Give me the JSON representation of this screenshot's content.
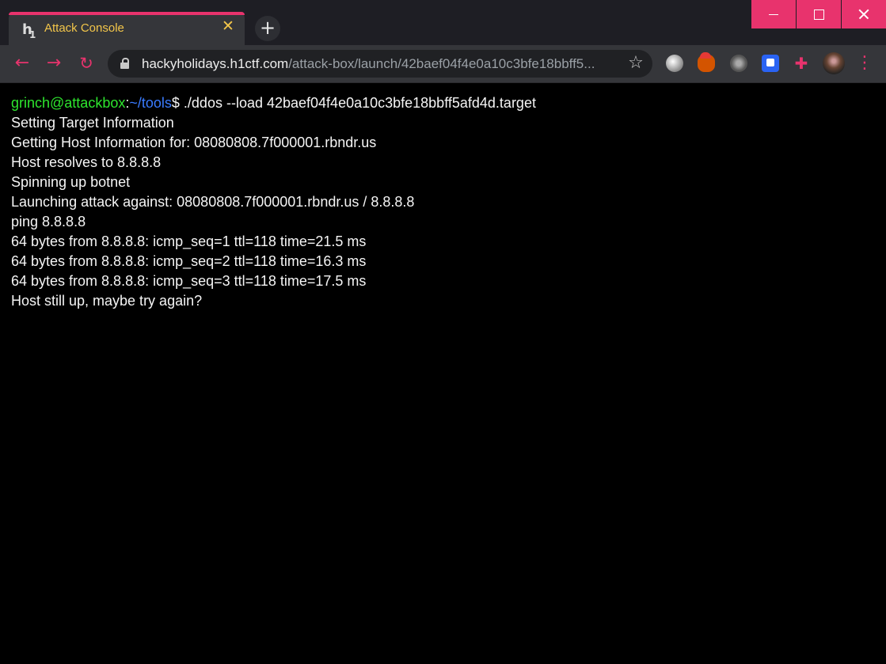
{
  "browser": {
    "tab": {
      "title": "Attack Console",
      "favicon": "h1-logo",
      "close_icon": "close-icon"
    },
    "new_tab_icon": "plus-icon",
    "window_controls": [
      "minimize-icon",
      "maximize-icon",
      "close-icon"
    ],
    "nav": {
      "back_icon": "arrow-left-icon",
      "forward_icon": "arrow-right-icon",
      "reload_icon": "reload-icon"
    },
    "address": {
      "host": "hackyholidays.h1ctf.com",
      "path": "/attack-box/launch/42baef04f4e0a10c3bfe18bbff5..."
    },
    "bookmark_icon": "star-icon",
    "extensions": [
      "extension-1-icon",
      "santa-hat-extension-icon",
      "extension-3-icon",
      "extension-4-icon",
      "puzzle-icon",
      "profile-avatar"
    ],
    "menu_icon": "kebab-menu-icon"
  },
  "accent_color": "#e8336d",
  "terminal": {
    "prompt": {
      "user": "grinch@attackbox",
      "colon": ":",
      "path": "~/tools",
      "symbol": "$",
      "command": " ./ddos --load 42baef04f4e0a10c3bfe18bbff5afd4d.target"
    },
    "output": [
      "Setting Target Information",
      "Getting Host Information for: 08080808.7f000001.rbndr.us",
      "Host resolves to 8.8.8.8",
      "Spinning up botnet",
      "Launching attack against: 08080808.7f000001.rbndr.us / 8.8.8.8",
      "ping 8.8.8.8",
      "64 bytes from 8.8.8.8: icmp_seq=1 ttl=118 time=21.5 ms",
      "64 bytes from 8.8.8.8: icmp_seq=2 ttl=118 time=16.3 ms",
      "64 bytes from 8.8.8.8: icmp_seq=3 ttl=118 time=17.5 ms",
      "Host still up, maybe try again?"
    ]
  }
}
